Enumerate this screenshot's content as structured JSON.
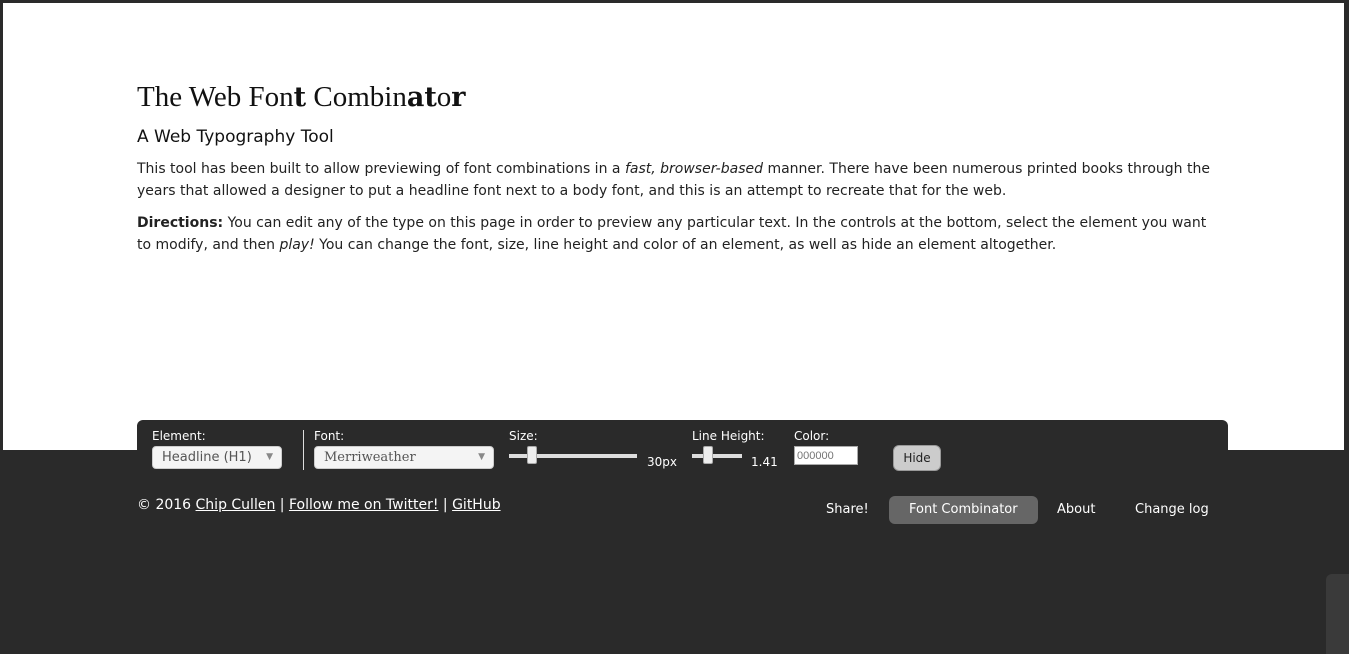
{
  "header": {
    "title_plain_1": "The Web Fon",
    "title_bold_1": "t",
    "title_plain_2": " Combin",
    "title_bold_2": "at",
    "title_plain_3": "o",
    "title_bold_3": "r",
    "subtitle": "A Web Typography Tool"
  },
  "intro": {
    "p1_a": "This tool has been built to allow previewing of font combinations in a ",
    "p1_em": "fast, browser-based",
    "p1_b": " manner. There have been numerous printed books through the years that allowed a designer to put a headline font next to a body font, and this is an attempt to recreate that for the web.",
    "p2_strong": "Directions:",
    "p2_a": " You can edit any of the type on this page in order to preview any particular text. In the controls at the bottom, select the element you want to modify, and then ",
    "p2_em": "play!",
    "p2_b": " You can change the font, size, line height and color of an element, as well as hide an element altogether."
  },
  "controls": {
    "element_label": "Element:",
    "element_value": "Headline (H1)",
    "font_label": "Font:",
    "font_value": "Merriweather",
    "size_label": "Size:",
    "size_value": "30px",
    "line_height_label": "Line Height:",
    "line_height_value": "1.41",
    "color_label": "Color:",
    "color_placeholder": "000000",
    "hide_label": "Hide"
  },
  "footer": {
    "copyright": "© 2016 ",
    "author": "Chip Cullen",
    "sep": " | ",
    "twitter": "Follow me on Twitter!",
    "github": "GitHub"
  },
  "nav": [
    {
      "label": "Share!"
    },
    {
      "label": "Font Combinator",
      "active": true
    },
    {
      "label": "About"
    },
    {
      "label": "Change log"
    }
  ]
}
